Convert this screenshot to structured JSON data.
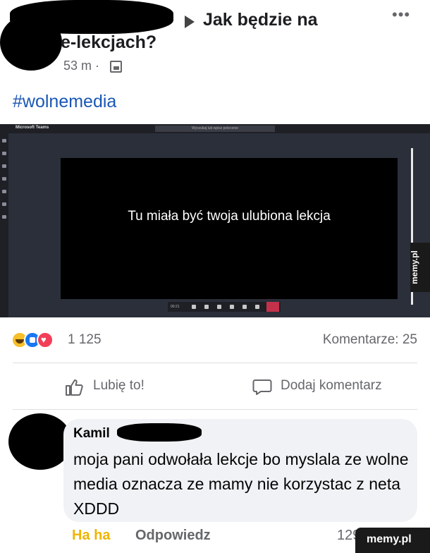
{
  "post": {
    "title_line1": "Jak będzie na",
    "title_line2": "e-lekcjach?",
    "time": "53 m ·",
    "hashtag": "#wolnemedia",
    "more": "•••"
  },
  "screenshot": {
    "app_name": "Microsoft Teams",
    "search_placeholder": "Wyszukaj lub wpisz polecenie",
    "lesson_text": "Tu miała być twoja ulubiona lekcja",
    "call_time": "00:21"
  },
  "stats": {
    "reactions_count": "1 125",
    "comments": "Komentarze: 25"
  },
  "actions": {
    "like": "Lubię to!",
    "comment": "Dodaj komentarz"
  },
  "comment": {
    "author": "Kamil",
    "text": "moja pani odwołała lekcje bo myslala ze wolne media oznacza ze mamy nie korzystac z neta XDDD",
    "reaction_label": "Ha ha",
    "reply": "Odpowiedz",
    "count": "129"
  },
  "watermark": "memy.pl",
  "icons": [
    "ellipsis-icon",
    "globe-icon",
    "haha-reaction-icon",
    "like-reaction-icon",
    "love-reaction-icon",
    "thumbs-up-icon",
    "comment-bubble-icon"
  ],
  "colors": {
    "hashtag": "#1a57b5",
    "haha": "#f0b400",
    "like": "#1877f2",
    "love": "#f33e58",
    "hangup": "#c4314b"
  }
}
